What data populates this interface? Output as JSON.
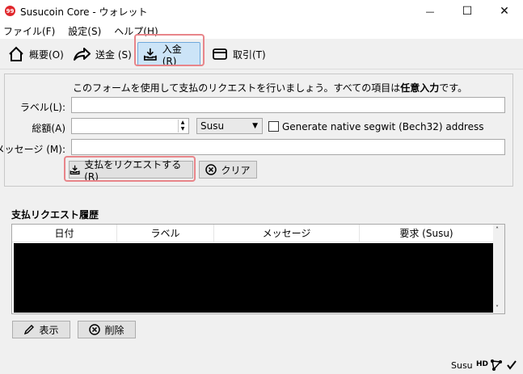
{
  "window": {
    "title": "Susucoin Core - ウォレット",
    "app_icon_text": "99",
    "minimize_glyph": "—",
    "maximize_glyph": "☐",
    "close_glyph": "✕"
  },
  "menu": {
    "items": [
      "ファイル(F)",
      "設定(S)",
      "ヘルプ(H)"
    ]
  },
  "toolbar": {
    "overview_label": "概要(O)",
    "send_label": "送金 (S)",
    "receive_label": "入金 (R)",
    "transactions_label": "取引(T)",
    "active_tab": "receive"
  },
  "form": {
    "info_prefix": "このフォームを使用して支払のリクエストを行いましょう。すべての項目は",
    "info_bold": "任意入力",
    "info_suffix": "です。",
    "label_label": "ラベル(L):",
    "label_value": "",
    "amount_label": "総額(A)",
    "amount_value": "",
    "unit_selected": "Susu",
    "segwit_label": "Generate native segwit (Bech32) address",
    "segwit_checked": false,
    "message_label": "メッセージ (M):",
    "message_value": "",
    "request_button": "支払をリクエストする (R)",
    "clear_button": "クリア"
  },
  "history": {
    "title": "支払リクエスト履歴",
    "columns": [
      "日付",
      "ラベル",
      "メッセージ",
      "要求 (Susu)"
    ],
    "show_button": "表示",
    "remove_button": "削除"
  },
  "status": {
    "unit": "Susu",
    "hd": "HD"
  },
  "colors": {
    "highlight": "#e8858a",
    "active_tab_bg": "#cce4f7"
  }
}
